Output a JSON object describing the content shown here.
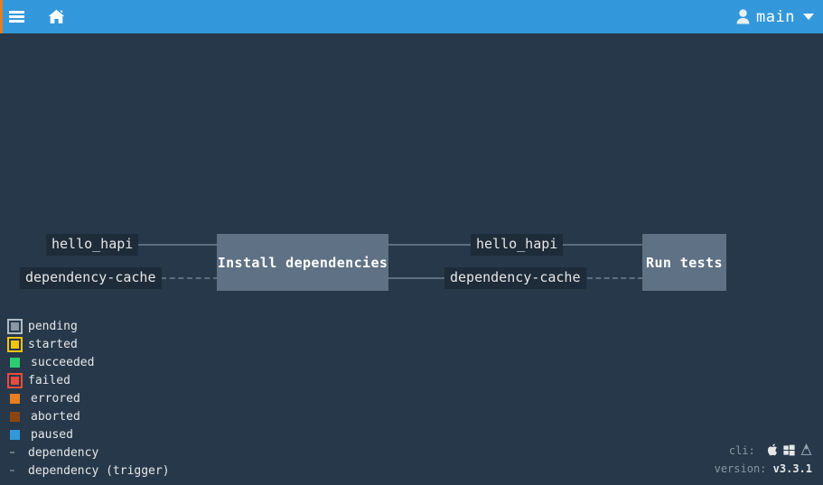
{
  "top_bar": {
    "menu_icon": "hamburger-icon",
    "home_icon": "home-icon",
    "user_icon": "user-icon",
    "username": "main",
    "caret_icon": "chevron-down-icon",
    "accent_color": "#3398db",
    "stripe_color": "#e67e22"
  },
  "pipeline": {
    "jobs": [
      {
        "name": "Install dependencies",
        "status": "pending"
      },
      {
        "name": "Run tests",
        "status": "pending"
      }
    ],
    "resources": [
      {
        "name": "hello_hapi",
        "kind": "dependency"
      },
      {
        "name": "dependency-cache",
        "kind": "dependency-trigger"
      },
      {
        "name": "hello_hapi",
        "kind": "dependency"
      },
      {
        "name": "dependency-cache",
        "kind": "dependency-trigger"
      }
    ],
    "job_color": "#5f7184",
    "edge_color": "#5c6f80",
    "resource_bg": "#1e2b38"
  },
  "legend": {
    "items": [
      {
        "label": "pending",
        "color": "#8a97a5",
        "style": "ringed",
        "ring": "#b3bcc4"
      },
      {
        "label": "started",
        "color": "#f1c40f",
        "style": "ringed",
        "ring": "#f1c40f"
      },
      {
        "label": "succeeded",
        "color": "#2ecc71",
        "style": "solid"
      },
      {
        "label": "failed",
        "color": "#e74c3c",
        "style": "ringed",
        "ring": "#e74c3c"
      },
      {
        "label": "errored",
        "color": "#e67e22",
        "style": "solid"
      },
      {
        "label": "aborted",
        "color": "#8b4513",
        "style": "solid"
      },
      {
        "label": "paused",
        "color": "#3398db",
        "style": "solid"
      },
      {
        "label": "dependency",
        "color": "#5c6f80",
        "style": "line-solid"
      },
      {
        "label": "dependency (trigger)",
        "color": "#5c6f80",
        "style": "line-dashed"
      }
    ]
  },
  "footer": {
    "cli_label": "cli:",
    "cli_icons": [
      "apple-icon",
      "windows-icon",
      "linux-icon"
    ],
    "version_label": "version:",
    "version_value": "v3.3.1"
  }
}
